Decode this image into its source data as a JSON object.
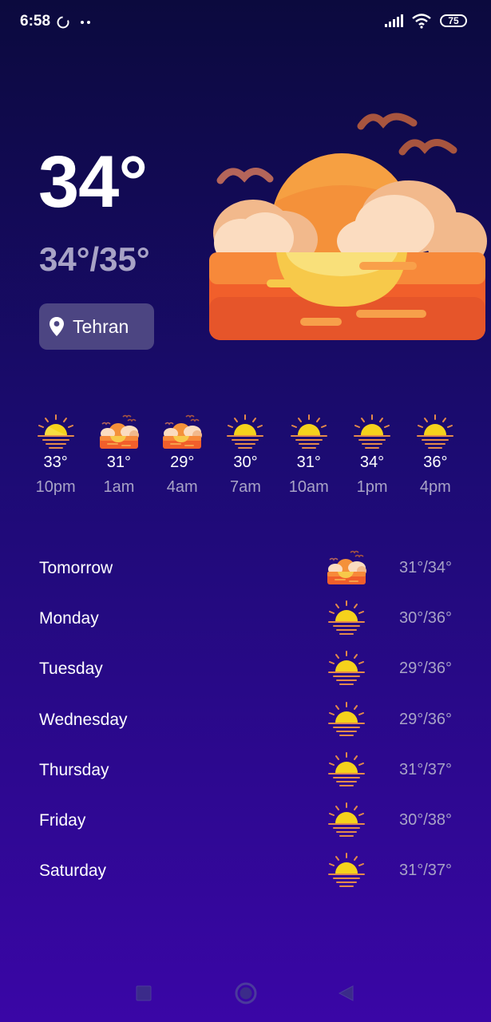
{
  "status_bar": {
    "time": "6:58",
    "battery": "75",
    "icons": [
      "sync-icon",
      "dots-icon",
      "signal-icon",
      "wifi-icon",
      "battery-icon"
    ]
  },
  "current": {
    "temperature": "34°",
    "hi_lo": "34°/35°",
    "location": "Tehran",
    "icon": "sunset-clouds-icon"
  },
  "hourly": [
    {
      "temp": "33°",
      "time": "10pm",
      "icon": "sunset-icon"
    },
    {
      "temp": "31°",
      "time": "1am",
      "icon": "sunset-clouds-icon"
    },
    {
      "temp": "29°",
      "time": "4am",
      "icon": "sunset-clouds-icon"
    },
    {
      "temp": "30°",
      "time": "7am",
      "icon": "sunset-icon"
    },
    {
      "temp": "31°",
      "time": "10am",
      "icon": "sunset-icon"
    },
    {
      "temp": "34°",
      "time": "1pm",
      "icon": "sunset-icon"
    },
    {
      "temp": "36°",
      "time": "4pm",
      "icon": "sunset-icon"
    }
  ],
  "daily": [
    {
      "day": "Tomorrow",
      "temps": "31°/34°",
      "icon": "sunset-clouds-icon"
    },
    {
      "day": "Monday",
      "temps": "30°/36°",
      "icon": "sunset-icon"
    },
    {
      "day": "Tuesday",
      "temps": "29°/36°",
      "icon": "sunset-icon"
    },
    {
      "day": "Wednesday",
      "temps": "29°/36°",
      "icon": "sunset-icon"
    },
    {
      "day": "Thursday",
      "temps": "31°/37°",
      "icon": "sunset-icon"
    },
    {
      "day": "Friday",
      "temps": "30°/38°",
      "icon": "sunset-icon"
    },
    {
      "day": "Saturday",
      "temps": "31°/37°",
      "icon": "sunset-icon"
    }
  ],
  "nav": [
    "recents-button",
    "home-button",
    "back-button"
  ],
  "colors": {
    "background_top": "#0b0a3e",
    "background_bottom": "#3a06a6",
    "muted_text": "#a8a3c6",
    "location_chip": "#4c4582",
    "sun": "#f5d21c",
    "sun_lines": "#e48a4a"
  }
}
